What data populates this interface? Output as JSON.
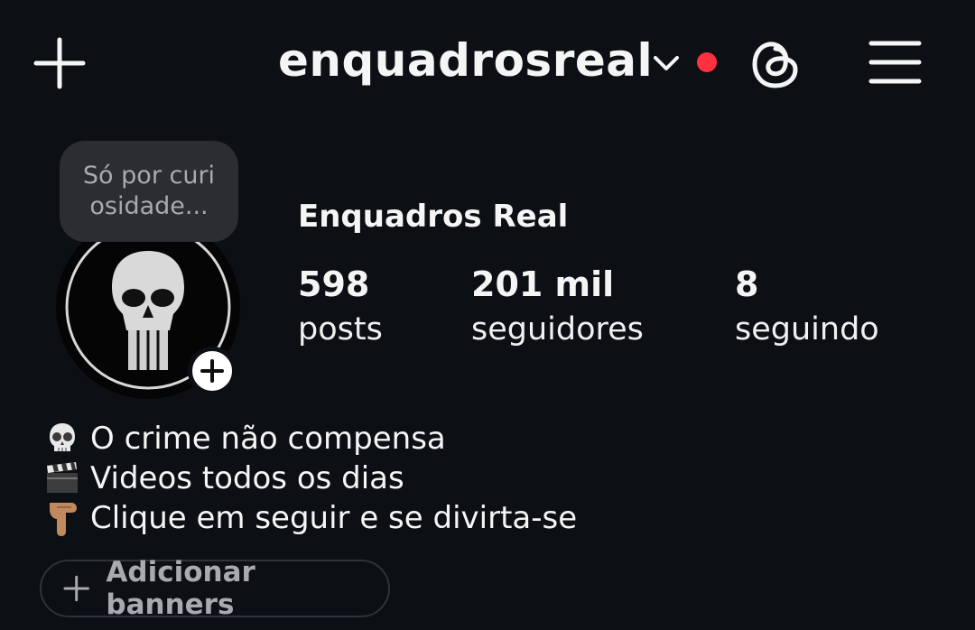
{
  "header": {
    "create_icon": "plus-icon",
    "username": "enquadrosreal",
    "switch_account_icon": "chevron-down-icon",
    "notification_dot_color": "#ff3040",
    "threads_icon": "threads-icon",
    "menu_icon": "hamburger-menu-icon"
  },
  "note": {
    "text": "Só por curi osidade..."
  },
  "profile": {
    "display_name": "Enquadros Real",
    "avatar_icon": "punisher-skull-logo",
    "add_story_icon": "plus-icon",
    "stats": {
      "posts": {
        "value": "598",
        "label": "posts"
      },
      "followers": {
        "value": "201 mil",
        "label": "seguidores"
      },
      "following": {
        "value": "8",
        "label": "seguindo"
      }
    }
  },
  "bio": {
    "lines": [
      {
        "emoji": "skull-icon",
        "text": "O crime não compensa"
      },
      {
        "emoji": "clapper-board-icon",
        "text": "Videos todos os dias"
      },
      {
        "emoji": "pointing-down-hand-icon",
        "text": "Clique em seguir e se divirta-se"
      }
    ]
  },
  "banners": {
    "label": "Adicionar banners",
    "icon": "plus-icon"
  },
  "colors": {
    "background": "#0c0f14",
    "text": "#f5f5f5",
    "muted": "#a8aab0",
    "note_bg": "#2b2d33"
  }
}
